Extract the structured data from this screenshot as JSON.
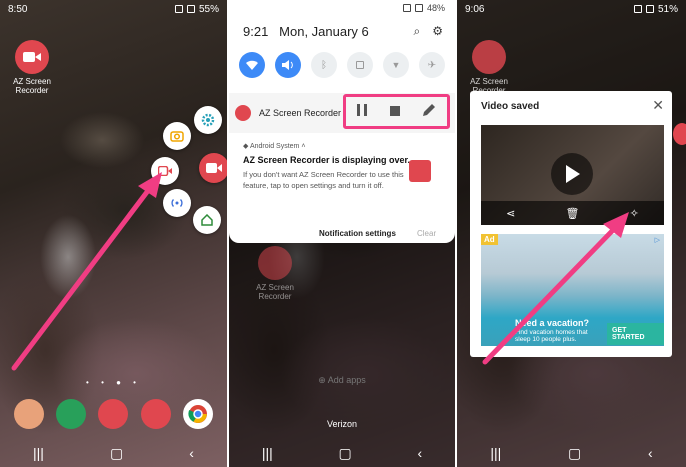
{
  "panel1": {
    "status": {
      "time": "8:50",
      "battery": "55%"
    },
    "app_label": "AZ Screen\nRecorder",
    "page_dots": "• • ● •"
  },
  "panel2": {
    "status": {
      "battery": "48%"
    },
    "clock": {
      "time": "9:21",
      "date": "Mon, January 6"
    },
    "recorder_notification": {
      "title": "AZ Screen Recorder"
    },
    "android_notification": {
      "source": "Android System",
      "title": "AZ Screen Recorder is displaying over..",
      "body": "If you don't want AZ Screen Recorder to use this feature, tap to open settings and turn it off."
    },
    "footer": {
      "settings": "Notification settings",
      "clear": "Clear"
    },
    "home_label": "AZ Screen\nRecorder",
    "add_apps": "Add apps",
    "carrier": "Verizon"
  },
  "panel3": {
    "status": {
      "time": "9:06",
      "battery": "51%"
    },
    "app_label": "AZ Screen\nRecorder",
    "dialog": {
      "title": "Video saved"
    },
    "ad": {
      "badge": "Ad",
      "headline": "Need a vacation?",
      "subtext": "Find vacation homes that sleep 10 people plus.",
      "cta": "GET STARTED"
    }
  },
  "colors": {
    "accent_pink": "#f03d83",
    "recorder_red": "#e0474f",
    "qs_blue": "#3d8af7"
  }
}
